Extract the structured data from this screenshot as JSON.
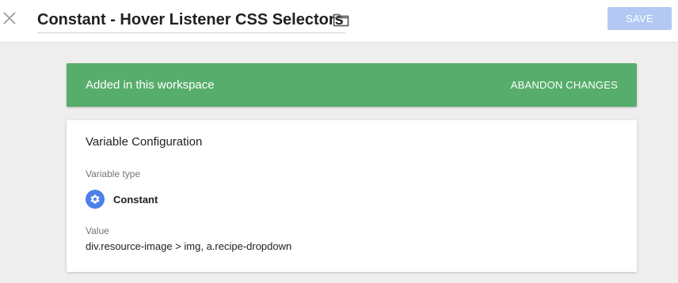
{
  "header": {
    "title": "Constant - Hover Listener CSS Selectors",
    "save_label": "SAVE",
    "close_icon": "close-icon",
    "folder_icon": "folder-icon"
  },
  "banner": {
    "message": "Added in this workspace",
    "abandon_label": "ABANDON CHANGES",
    "color": "#57ad6b"
  },
  "config": {
    "heading": "Variable Configuration",
    "type_label": "Variable type",
    "type_name": "Constant",
    "type_icon": "gear-icon",
    "value_label": "Value",
    "value": "div.resource-image > img, a.recipe-dropdown"
  },
  "colors": {
    "accent": "#4d80e8",
    "save_disabled": "#b3c9f3"
  }
}
